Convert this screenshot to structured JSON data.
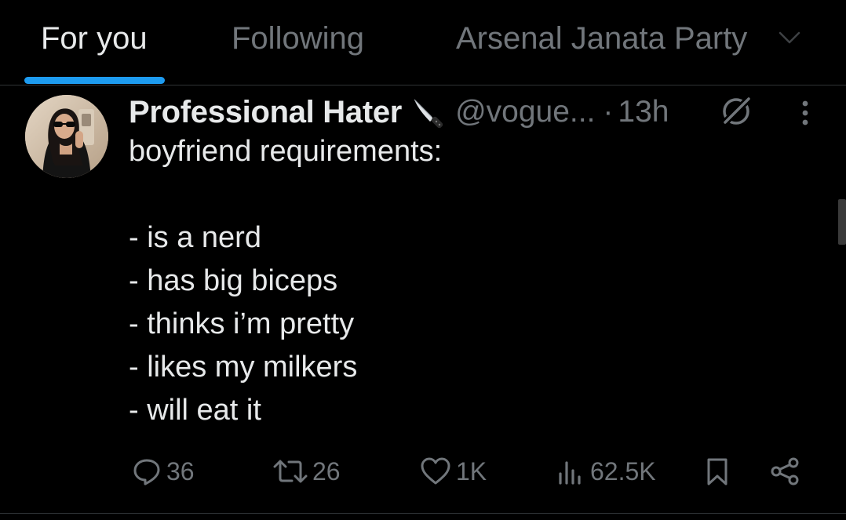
{
  "tabs": [
    {
      "label": "For you",
      "active": true
    },
    {
      "label": "Following",
      "active": false
    },
    {
      "label": "Arsenal Janata Party",
      "active": false
    }
  ],
  "post": {
    "display_name": "Professional Hater",
    "name_emoji": "knife-icon",
    "handle": "@vogue...",
    "separator": "·",
    "time": "13h",
    "body_lines": [
      "boyfriend requirements:",
      "",
      "- is a nerd",
      "- has big biceps",
      "- thinks i’m pretty",
      "- likes my milkers",
      "- will eat it"
    ],
    "actions": {
      "replies": "36",
      "reposts": "26",
      "likes": "1K",
      "views": "62.5K"
    }
  },
  "colors": {
    "background": "#000000",
    "text_primary": "#e7e9ea",
    "text_secondary": "#71767b",
    "accent": "#1d9bf0",
    "divider": "#2f3336"
  }
}
